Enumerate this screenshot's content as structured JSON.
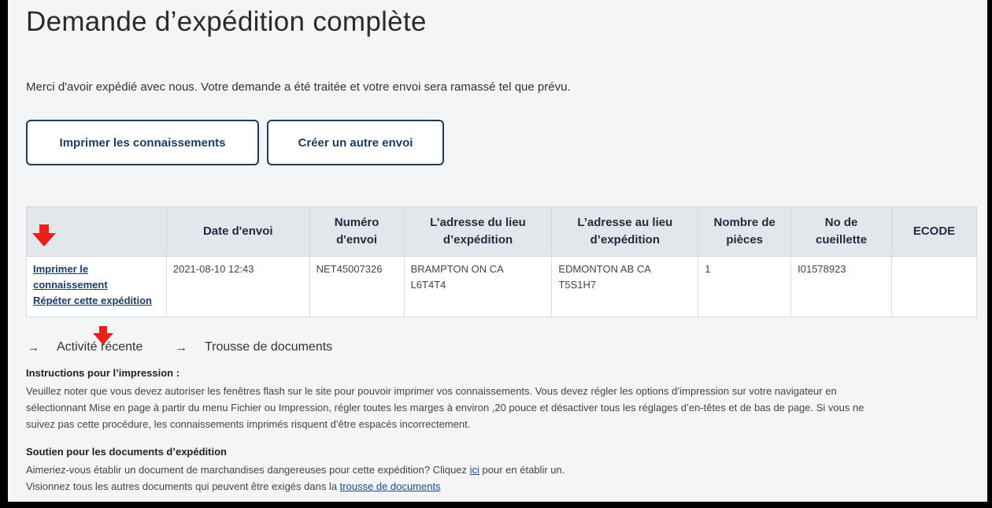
{
  "title": "Demande d’expédition complète",
  "intro": "Merci d'avoir expédié avec nous. Votre demande a été traitée et votre envoi sera ramassé tel que prévu.",
  "buttons": {
    "print": "Imprimer les connaissements",
    "create": "Créer un autre envoi"
  },
  "table": {
    "headers": {
      "date": "Date d'envoi",
      "number_l1": "Numéro",
      "number_l2": "d'envoi",
      "origin_l1": "L’adresse du lieu",
      "origin_l2": "d’expédition",
      "dest_l1": "L’adresse au lieu",
      "dest_l2": "d’expédition",
      "pieces_l1": "Nombre de",
      "pieces_l2": "pièces",
      "pickup_l1": "No de",
      "pickup_l2": "cueillette",
      "ecode": "ECODE"
    },
    "row": {
      "print_link_l1": "Imprimer le",
      "print_link_l2": "connaissement",
      "repeat_link": "Répéter cette expédition",
      "date": "2021-08-10 12:43",
      "number": "NET45007326",
      "origin_l1": "BRAMPTON ON CA",
      "origin_l2": "L6T4T4",
      "dest_l1": "EDMONTON AB CA",
      "dest_l2": "T5S1H7",
      "pieces": "1",
      "pickup": "I01578923",
      "ecode": ""
    }
  },
  "nav": {
    "recent": "Activité récente",
    "documents": "Trousse de documents"
  },
  "print_instructions": {
    "heading": "Instructions pour l’impression :",
    "text_l1": "Veuillez noter que vous devez autoriser les fenêtres flash sur le site pour pouvoir imprimer vos connaissements. Vous devez régler les options d’impression sur votre navigateur en",
    "text_l2": "sélectionnant Mise en page à partir du menu Fichier ou Impression, régler toutes les marges à environ ,20 pouce et désactiver tous les réglages d’en-têtes et de bas de page. Si vous ne",
    "text_l3": "suivez pas cette procédure, les connaissements imprimés risquent d’être espacés incorrectement."
  },
  "support": {
    "heading": "Soutien pour les documents d’expédition",
    "dg_before": "Aimeriez-vous établir un document de marchandises dangereuses pour cette expédition? Cliquez ",
    "dg_link": "ici",
    "dg_after": " pour en établir un.",
    "docs_before": "Visionnez tous les autres documents qui peuvent être exigés dans la ",
    "docs_link": "trousse de documents"
  },
  "colors": {
    "primary": "#1f3b5c",
    "annotation_arrow": "#e8201a",
    "header_bg": "#e3e6ea",
    "page_bg": "#f4f5f7"
  },
  "icons": {
    "annotation": "red-down-arrow-icon",
    "nav": "right-arrow-icon"
  }
}
